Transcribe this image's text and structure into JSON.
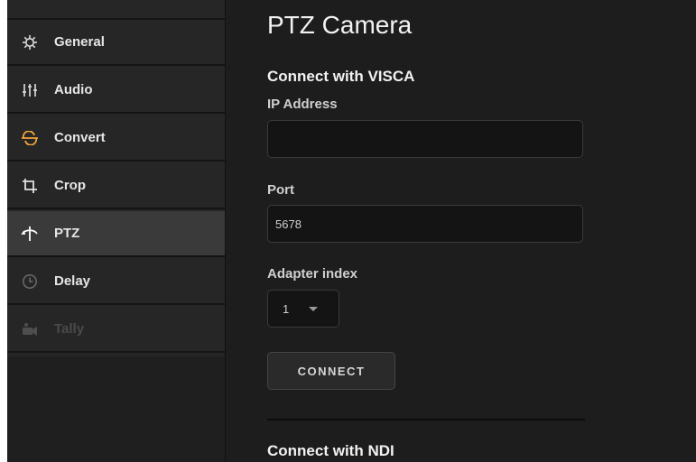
{
  "sidebar": {
    "items": [
      {
        "label": "General",
        "icon": "gear-icon",
        "active": false,
        "disabled": false
      },
      {
        "label": "Audio",
        "icon": "audio-sliders-icon",
        "active": false,
        "disabled": false
      },
      {
        "label": "Convert",
        "icon": "convert-icon",
        "active": false,
        "disabled": false
      },
      {
        "label": "Crop",
        "icon": "crop-icon",
        "active": false,
        "disabled": false
      },
      {
        "label": "PTZ",
        "icon": "ptz-icon",
        "active": true,
        "disabled": false
      },
      {
        "label": "Delay",
        "icon": "clock-icon",
        "active": false,
        "disabled": false
      },
      {
        "label": "Tally",
        "icon": "tally-camera-icon",
        "active": false,
        "disabled": true
      }
    ]
  },
  "main": {
    "title": "PTZ Camera",
    "visca": {
      "section_title": "Connect with VISCA",
      "ip_label": "IP Address",
      "ip_value": "",
      "port_label": "Port",
      "port_value": "5678",
      "adapter_label": "Adapter index",
      "adapter_value": "1",
      "connect_label": "CONNECT"
    },
    "ndi": {
      "section_title": "Connect with NDI"
    }
  },
  "colors": {
    "accent": "#f0a33a",
    "background": "#1d1d1d",
    "sidebar_bg": "#262626",
    "active_item_bg": "#3a3a3a"
  }
}
